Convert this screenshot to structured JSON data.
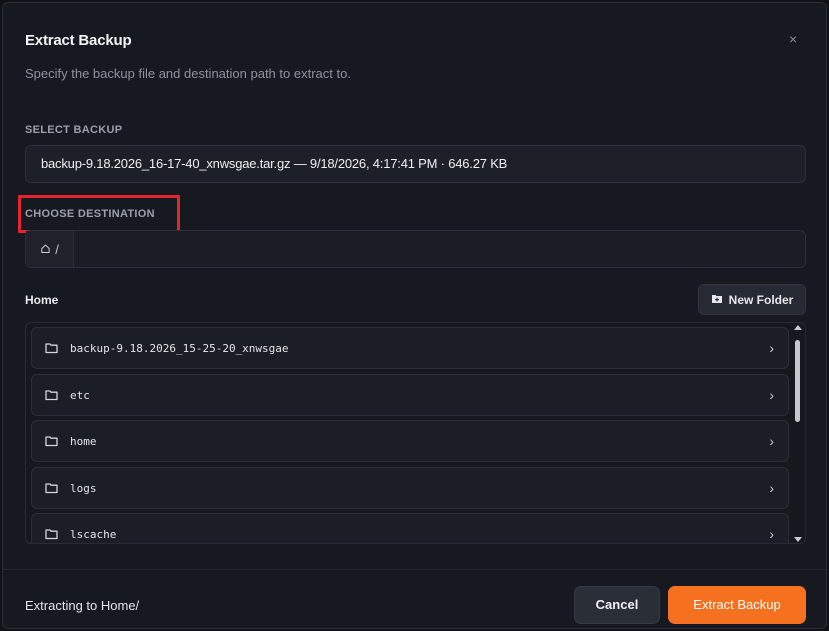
{
  "dialog": {
    "title": "Extract Backup",
    "subtitle": "Specify the backup file and destination path to extract to.",
    "close_label": "×"
  },
  "backup": {
    "label": "SELECT BACKUP",
    "selected": "backup-9.18.2026_16-17-40_xnwsgae.tar.gz — 9/18/2026, 4:17:41 PM · 646.27 KB"
  },
  "destination": {
    "label": "CHOOSE DESTINATION",
    "prefix": "/",
    "prefix_icon": "home-icon",
    "value": "",
    "placeholder": ""
  },
  "browser": {
    "breadcrumb": "Home",
    "new_folder_label": "New Folder",
    "new_folder_icon": "folder-plus-icon",
    "folder_icon": "folder-icon",
    "chevron": "›",
    "items": [
      {
        "name": "backup-9.18.2026_15-25-20_xnwsgae"
      },
      {
        "name": "etc"
      },
      {
        "name": "home"
      },
      {
        "name": "logs"
      },
      {
        "name": "lscache"
      }
    ]
  },
  "footer": {
    "status": "Extracting to Home/",
    "cancel_label": "Cancel",
    "extract_label": "Extract Backup"
  },
  "colors": {
    "accent": "#f5701f",
    "highlight": "#e32431",
    "background": "#16191f"
  }
}
